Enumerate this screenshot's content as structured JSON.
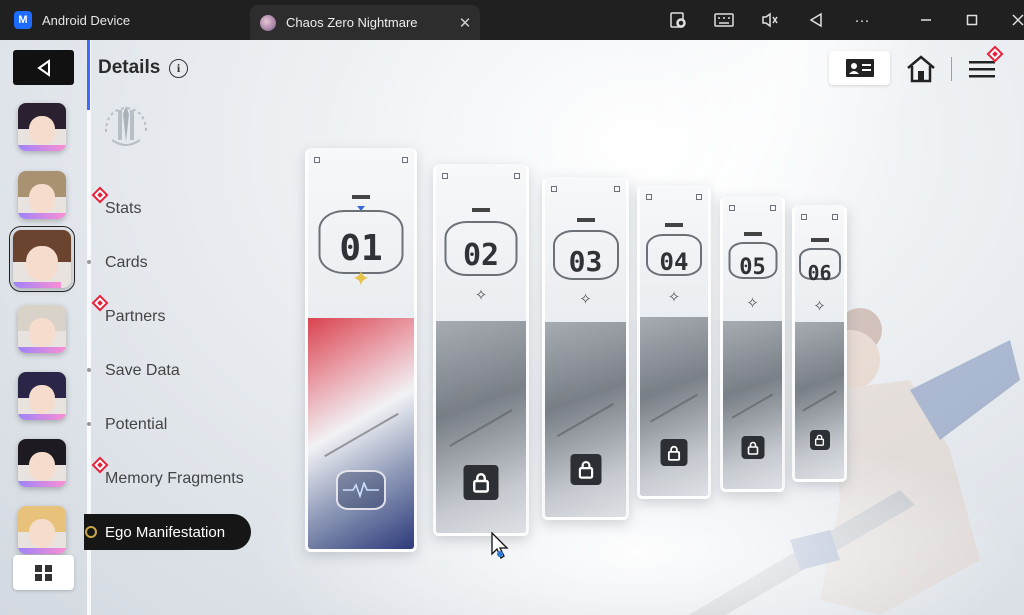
{
  "window": {
    "app_tab_label": "Android Device",
    "game_tab_label": "Chaos Zero Nightmare",
    "tab_close": "✕"
  },
  "toolbar": {
    "icons": [
      "screen-record-icon",
      "keyboard-icon",
      "mute-icon",
      "back-triangle-icon",
      "more-icon",
      "minimize-icon",
      "maximize-icon",
      "close-icon"
    ],
    "more": "···"
  },
  "sidebar": {
    "characters": [
      {
        "hair": "#2a2030",
        "selected": false
      },
      {
        "hair": "#a89272",
        "selected": false
      },
      {
        "hair": "#6b4430",
        "selected": true
      },
      {
        "hair": "#d9d2c8",
        "selected": false
      },
      {
        "hair": "#2b2548",
        "selected": false
      },
      {
        "hair": "#1e1a22",
        "selected": false
      },
      {
        "hair": "#e8c27a",
        "selected": false
      }
    ]
  },
  "details": {
    "title": "Details",
    "info": "i",
    "menu": [
      "Stats",
      "Cards",
      "Partners",
      "Save Data",
      "Potential",
      "Memory Fragments"
    ],
    "active": "Ego Manifestation"
  },
  "cards": [
    {
      "number": "01",
      "locked": false
    },
    {
      "number": "02",
      "locked": true
    },
    {
      "number": "03",
      "locked": true
    },
    {
      "number": "04",
      "locked": true
    },
    {
      "number": "05",
      "locked": true
    },
    {
      "number": "06",
      "locked": true
    }
  ],
  "colors": {
    "accent_blue": "#3d6bff",
    "alert_red": "#e8213b",
    "dark_button": "#111111"
  }
}
